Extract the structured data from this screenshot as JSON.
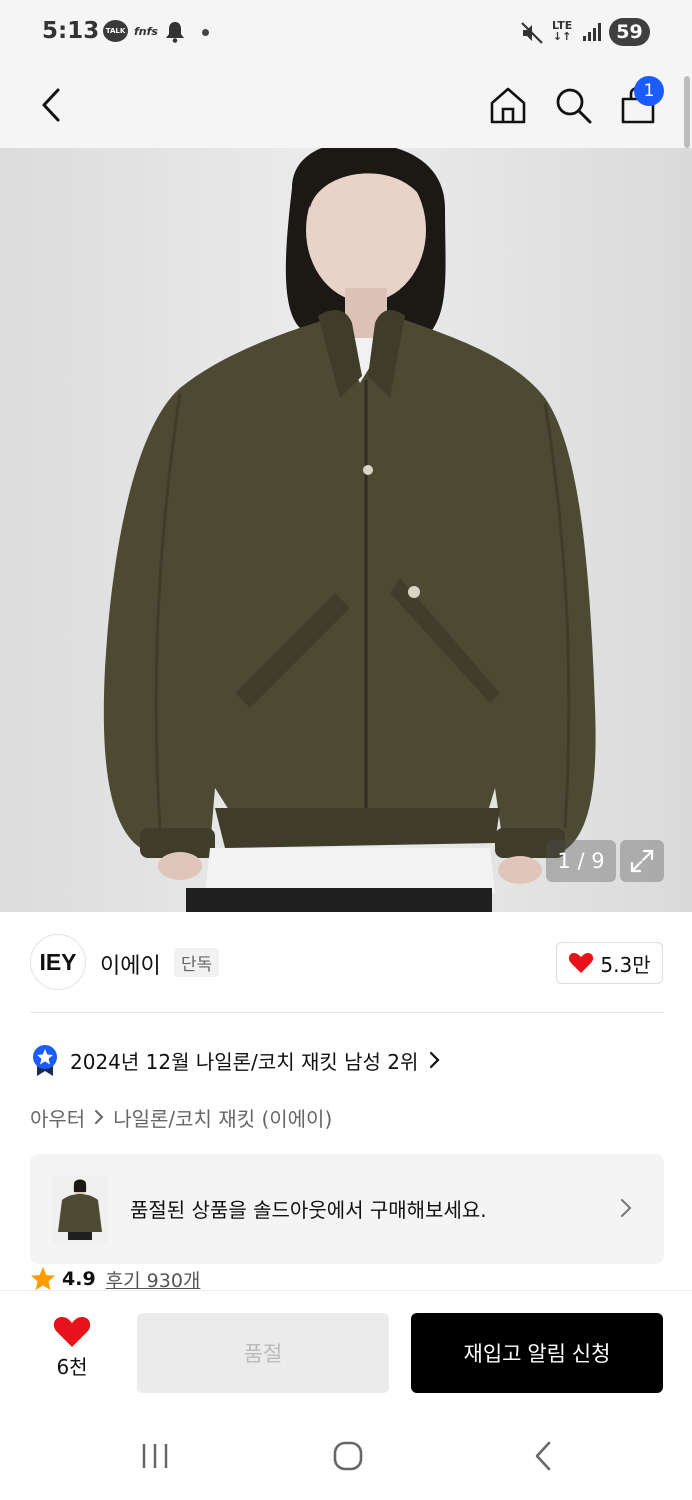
{
  "status_bar": {
    "time": "5:13",
    "talk_label": "TALK",
    "app_label": "fnfs",
    "lte_label": "LTE",
    "battery": "59"
  },
  "header": {
    "cart_count": "1"
  },
  "product": {
    "image_counter": "1 / 9"
  },
  "brand": {
    "logo_text": "IEY",
    "name": "이에이",
    "tag": "단독",
    "likes": "5.3만"
  },
  "ranking": {
    "text": "2024년 12월 나일론/코치 재킷 남성 2위"
  },
  "breadcrumb": {
    "category": "아우터",
    "subcategory": "나일론/코치 재킷 (이에이)"
  },
  "banner": {
    "text": "품절된 상품을 솔드아웃에서 구매해보세요."
  },
  "review": {
    "rating": "4.9",
    "link": "후기 930개"
  },
  "bottom_bar": {
    "wish_count": "6천",
    "soldout_label": "품절",
    "restock_label": "재입고 알림 신청"
  },
  "colors": {
    "accent_blue": "#1a5cff",
    "heart_red": "#e8121a",
    "star_orange": "#ff9d00",
    "jacket_olive": "#4c4a33"
  }
}
